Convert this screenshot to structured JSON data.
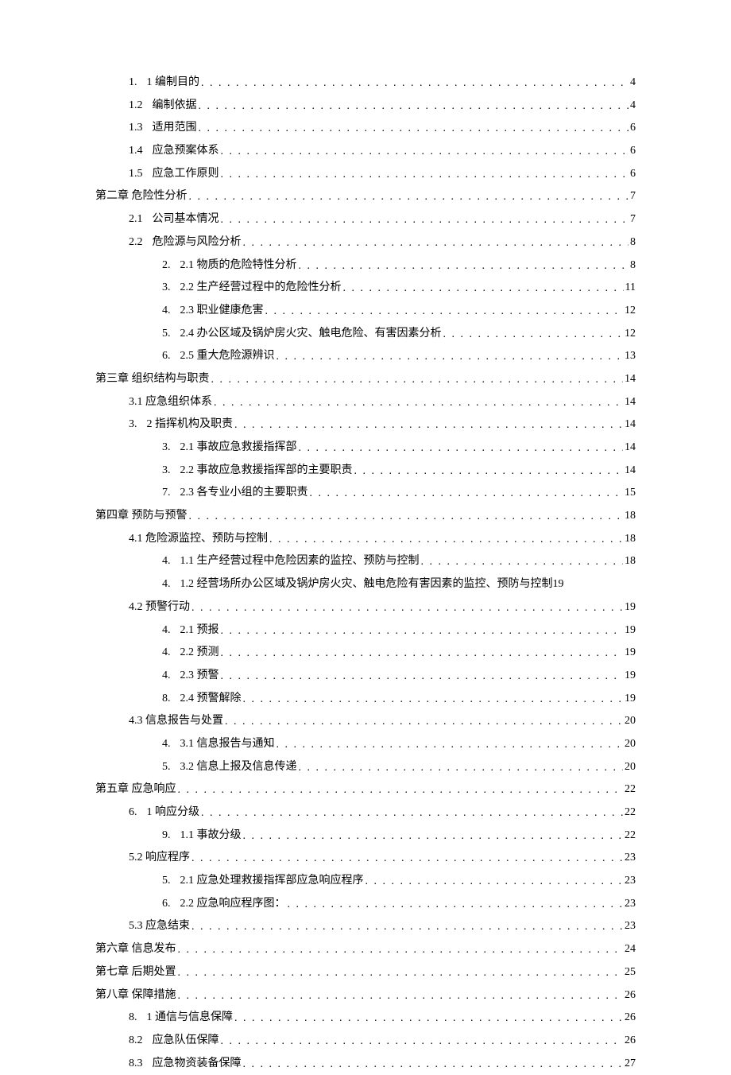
{
  "entries": [
    {
      "level": 1,
      "num": "1.",
      "sep": true,
      "label": "1 编制目的",
      "page": "4"
    },
    {
      "level": 1,
      "num": "1.2",
      "sep": true,
      "label": "编制依据",
      "page": "4"
    },
    {
      "level": 1,
      "num": "1.3",
      "sep": true,
      "label": "适用范围",
      "page": "6"
    },
    {
      "level": 1,
      "num": "1.4",
      "sep": true,
      "label": "应急预案体系",
      "page": "6"
    },
    {
      "level": 1,
      "num": "1.5",
      "sep": true,
      "label": "应急工作原则",
      "page": "6"
    },
    {
      "level": 0,
      "num": "",
      "sep": false,
      "label": "第二章 危险性分析",
      "page": "7"
    },
    {
      "level": 1,
      "num": "2.1",
      "sep": true,
      "label": "公司基本情况",
      "page": "7"
    },
    {
      "level": 1,
      "num": "2.2",
      "sep": true,
      "label": "危险源与风险分析",
      "page": "8"
    },
    {
      "level": 2,
      "num": "2.",
      "sep": true,
      "label": "2.1 物质的危险特性分析",
      "page": "8"
    },
    {
      "level": 2,
      "num": "3.",
      "sep": true,
      "label": "2.2 生产经营过程中的危险性分析",
      "page": "11"
    },
    {
      "level": 2,
      "num": "4.",
      "sep": true,
      "label": "2.3 职业健康危害",
      "page": "12"
    },
    {
      "level": 2,
      "num": "5.",
      "sep": true,
      "label": "2.4 办公区域及锅炉房火灾、触电危险、有害因素分析",
      "page": "12"
    },
    {
      "level": 2,
      "num": "6.",
      "sep": true,
      "label": "2.5 重大危险源辨识",
      "page": "13"
    },
    {
      "level": 0,
      "num": "",
      "sep": false,
      "label": "第三章 组织结构与职责",
      "page": "14"
    },
    {
      "level": 1,
      "num": "",
      "sep": false,
      "label": "3.1 应急组织体系",
      "page": "14"
    },
    {
      "level": 1,
      "num": "3.",
      "sep": true,
      "label": "2 指挥机构及职责",
      "page": "14"
    },
    {
      "level": 2,
      "num": "3.",
      "sep": true,
      "label": "2.1 事故应急救援指挥部",
      "page": "14"
    },
    {
      "level": 2,
      "num": "3.",
      "sep": true,
      "label": "2.2 事故应急救援指挥部的主要职责",
      "page": "14"
    },
    {
      "level": 2,
      "num": "7.",
      "sep": true,
      "label": "2.3 各专业小组的主要职责",
      "page": "15"
    },
    {
      "level": 0,
      "num": "",
      "sep": false,
      "label": "第四章 预防与预警",
      "page": "18"
    },
    {
      "level": 1,
      "num": "",
      "sep": false,
      "label": "4.1 危险源监控、预防与控制",
      "page": "18"
    },
    {
      "level": 2,
      "num": "4.",
      "sep": true,
      "label": "1.1 生产经营过程中危险因素的监控、预防与控制",
      "page": "18"
    },
    {
      "level": 2,
      "num": "4.",
      "sep": true,
      "label": "1.2 经营场所办公区域及锅炉房火灾、触电危险有害因素的监控、预防与控制",
      "page": "19",
      "nodots": true
    },
    {
      "level": 1,
      "num": "",
      "sep": false,
      "label": "4.2 预警行动",
      "page": "19"
    },
    {
      "level": 2,
      "num": "4.",
      "sep": true,
      "label": "2.1 预报",
      "page": "19"
    },
    {
      "level": 2,
      "num": "4.",
      "sep": true,
      "label": "2.2 预测",
      "page": "19"
    },
    {
      "level": 2,
      "num": "4.",
      "sep": true,
      "label": "2.3 预警",
      "page": "19"
    },
    {
      "level": 2,
      "num": "8.",
      "sep": true,
      "label": "2.4 预警解除",
      "page": "19"
    },
    {
      "level": 1,
      "num": "",
      "sep": false,
      "label": "4.3 信息报告与处置",
      "page": "20"
    },
    {
      "level": 2,
      "num": "4.",
      "sep": true,
      "label": "3.1 信息报告与通知",
      "page": "20"
    },
    {
      "level": 2,
      "num": "5.",
      "sep": true,
      "label": "3.2 信息上报及信息传递",
      "page": "20"
    },
    {
      "level": 0,
      "num": "",
      "sep": false,
      "label": "第五章 应急响应",
      "page": "22"
    },
    {
      "level": 1,
      "num": "6.",
      "sep": true,
      "label": "1 响应分级",
      "page": "22"
    },
    {
      "level": 2,
      "num": "9.",
      "sep": true,
      "label": "1.1 事故分级",
      "page": "22"
    },
    {
      "level": 1,
      "num": "",
      "sep": false,
      "label": "5.2 响应程序",
      "page": "23"
    },
    {
      "level": 2,
      "num": "5.",
      "sep": true,
      "label": "2.1 应急处理救援指挥部应急响应程序",
      "page": "23"
    },
    {
      "level": 2,
      "num": "6.",
      "sep": true,
      "label": "2.2 应急响应程序图：",
      "page": "23"
    },
    {
      "level": 1,
      "num": "",
      "sep": false,
      "label": "5.3 应急结束",
      "page": "23"
    },
    {
      "level": 0,
      "num": "",
      "sep": false,
      "label": "第六章 信息发布",
      "page": "24"
    },
    {
      "level": 0,
      "num": "",
      "sep": false,
      "label": "第七章 后期处置",
      "page": "25"
    },
    {
      "level": 0,
      "num": "",
      "sep": false,
      "label": "第八章 保障措施",
      "page": "26"
    },
    {
      "level": 1,
      "num": "8.",
      "sep": true,
      "label": "1 通信与信息保障",
      "page": "26"
    },
    {
      "level": 1,
      "num": "8.2",
      "sep": true,
      "label": "应急队伍保障",
      "page": "26"
    },
    {
      "level": 1,
      "num": "8.3",
      "sep": true,
      "label": "应急物资装备保障",
      "page": "27"
    }
  ]
}
